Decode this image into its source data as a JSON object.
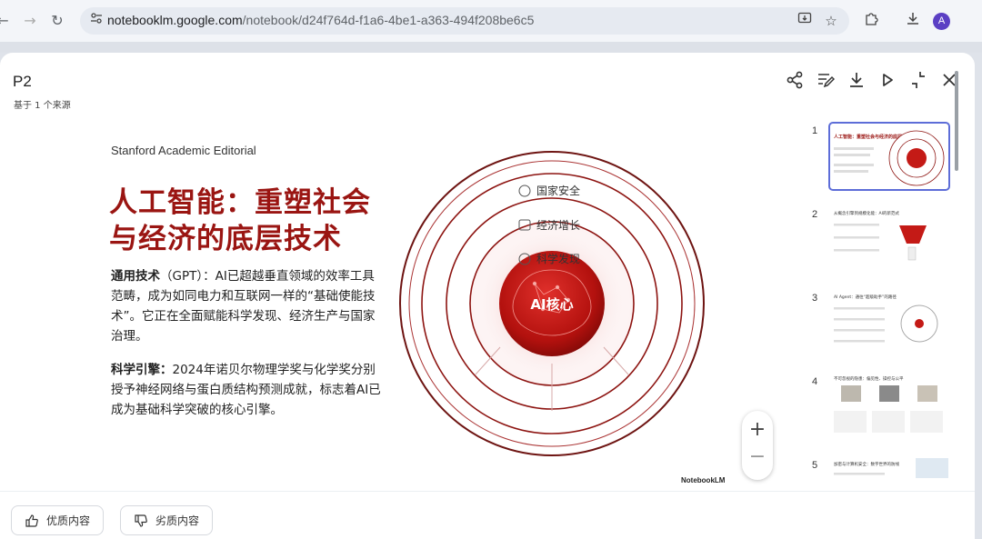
{
  "browser": {
    "url_host": "notebooklm.google.com",
    "url_path": "/notebook/d24f764d-f1a6-4be1-a363-494f208be6c5",
    "profile_initial": "A"
  },
  "dialog": {
    "title": "P2",
    "subtitle": "基于 1 个来源",
    "actions": [
      "share-icon",
      "edit-icon",
      "download-icon",
      "play-icon",
      "collapse-icon",
      "close-icon"
    ]
  },
  "slide": {
    "brand": "Stanford Academic Editorial",
    "headline_line1": "人工智能：重塑社会",
    "headline_line2": "与经济的底层技术",
    "para1_bold": "通用技术",
    "para1_text": "（GPT）：AI已超越垂直领域的效率工具范畴，成为如同电力和互联网一样的“基础使能技术”。它正在全面赋能科学发现、经济生产与国家治理。",
    "para2_bold": "科学引擎：",
    "para2_text": "2024年诺贝尔物理学奖与化学奖分别授予神经网络与蛋白质结构预测成就，标志着AI已成为基础科学突破的核心引擎。",
    "rings": [
      "国家安全",
      "经济增长",
      "科学发现"
    ],
    "core_label": "AI核心",
    "logo_text": "NotebookLM",
    "colors": {
      "accent": "#9a1512",
      "core": "#c41a16"
    }
  },
  "zoom": {
    "plus": "+",
    "minus": "−"
  },
  "thumbnails": [
    {
      "num": "1",
      "title": "人工智能：重塑社会与经济的底层技术"
    },
    {
      "num": "2",
      "title": "从概念引擎到规模化能：AI的新范式"
    },
    {
      "num": "3",
      "title": "AI Agent：通往“超级助手”的路径"
    },
    {
      "num": "4",
      "title": "不可忽视的隐患：偏见性、操控与公平"
    },
    {
      "num": "5",
      "title": "加密与计算机安全：数字世界的防线"
    }
  ],
  "feedback": {
    "good": "优质内容",
    "bad": "劣质内容"
  }
}
